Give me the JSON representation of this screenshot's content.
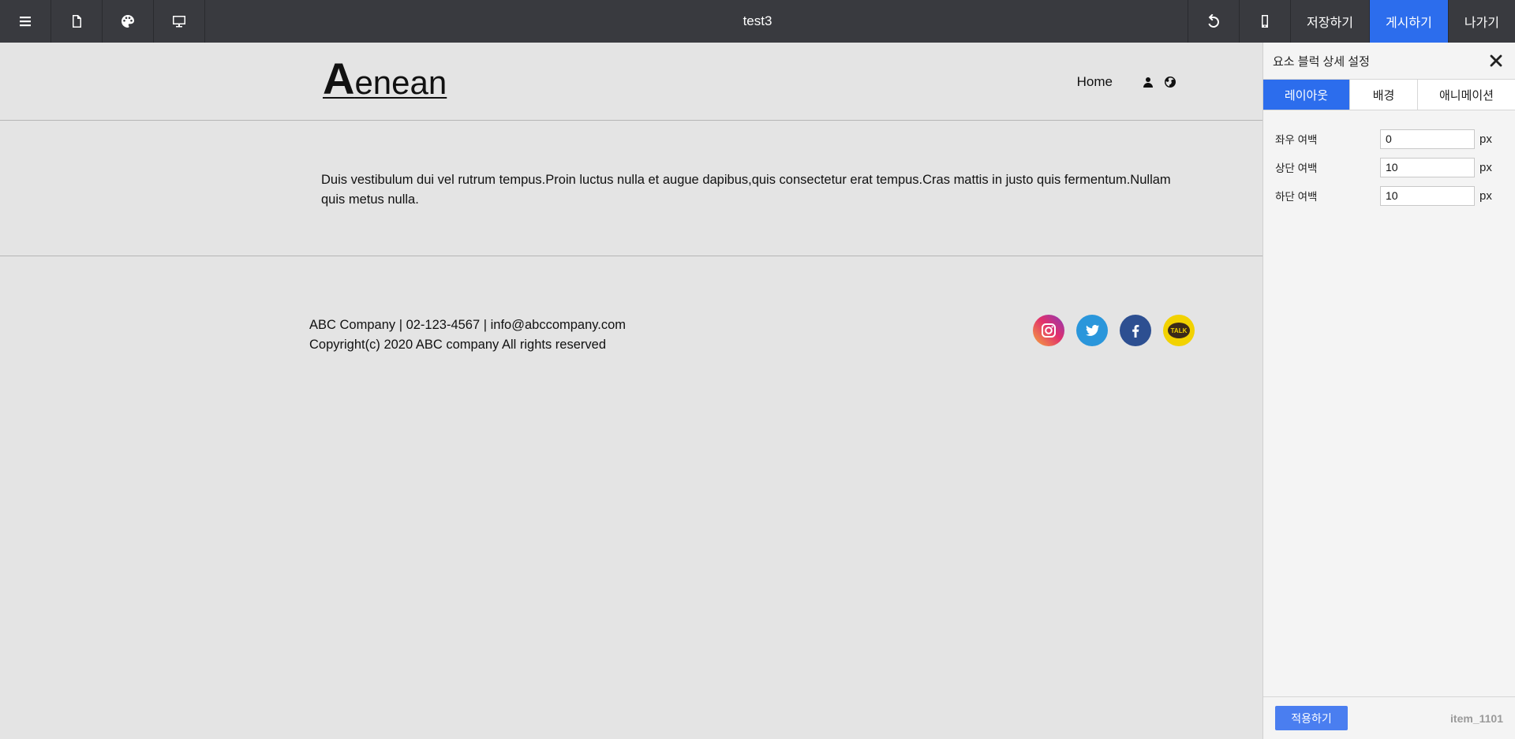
{
  "topbar": {
    "title": "test3",
    "save_label": "저장하기",
    "publish_label": "게시하기",
    "exit_label": "나가기",
    "accent_color": "#2c6ded"
  },
  "site": {
    "logo_initial": "A",
    "logo_rest": "enean",
    "nav_home": "Home",
    "body_text": "Duis vestibulum dui vel rutrum tempus.Proin luctus nulla et augue dapibus,quis consectetur erat tempus.Cras mattis in justo quis fermentum.Nullam quis metus nulla.",
    "footer_line1": "ABC Company | 02-123-4567 | info@abccompany.com",
    "footer_line2": "Copyright(c) 2020 ABC company All rights reserved",
    "social": [
      "instagram-icon",
      "twitter-icon",
      "facebook-icon",
      "kakaotalk-icon"
    ],
    "kakao_label": "TALK"
  },
  "panel": {
    "title": "요소 블럭 상세 설정",
    "tabs": [
      "레이아웃",
      "배경",
      "애니메이션"
    ],
    "active_tab": "레이아웃",
    "fields": [
      {
        "label": "좌우 여백",
        "value": "0",
        "unit": "px"
      },
      {
        "label": "상단 여백",
        "value": "10",
        "unit": "px"
      },
      {
        "label": "하단 여백",
        "value": "10",
        "unit": "px"
      }
    ],
    "apply_label": "적용하기",
    "item_id": "item_1101"
  }
}
